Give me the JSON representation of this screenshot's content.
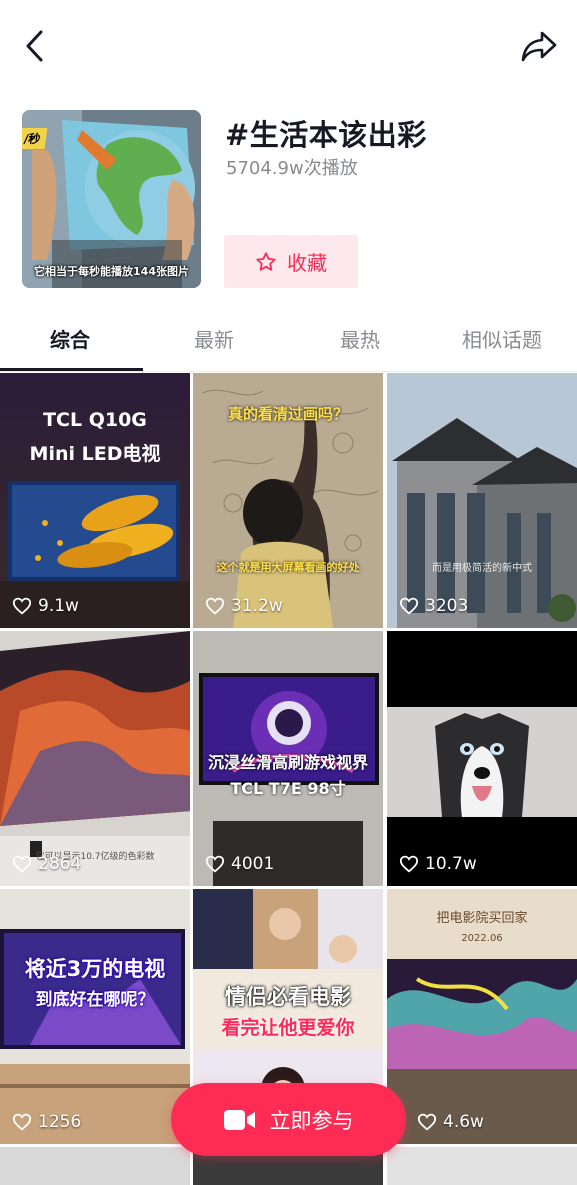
{
  "topic": {
    "title": "#生活本该出彩",
    "views": "5704.9w次播放",
    "favorite_label": "收藏",
    "cover_caption": "它相当于每秒能播放144张图片",
    "cover_tag": "/秒"
  },
  "tabs": [
    {
      "label": "综合",
      "active": true
    },
    {
      "label": "最新",
      "active": false
    },
    {
      "label": "最热",
      "active": false
    },
    {
      "label": "相似话题",
      "active": false
    }
  ],
  "videos": [
    {
      "likes": "9.1w",
      "text_top": "TCL Q10G",
      "text_bottom": "Mini LED电视"
    },
    {
      "likes": "31.2w",
      "text_top": "真的看清过画吗？",
      "text_bottom": "这个就是用大屏幕看画的好处"
    },
    {
      "likes": "3203",
      "text_bottom": "而是用极简活的新中式"
    },
    {
      "likes": "2864",
      "text_bottom": "它可以显示10.7亿级的色彩数"
    },
    {
      "likes": "4001",
      "text_top": "沉浸丝滑高刷游戏视界",
      "text_bottom": "TCL T7E 98寸"
    },
    {
      "likes": "10.7w"
    },
    {
      "likes": "1256",
      "text_top": "将近3万的电视",
      "text_bottom": "到底好在哪呢？"
    },
    {
      "likes": "",
      "text_top": "情侣必看电影",
      "text_bottom": "看完让他更爱你"
    },
    {
      "likes": "4.6w",
      "text_top": "把电影院买回家",
      "text_bottom": "2022.06"
    }
  ],
  "join_button": {
    "label": "立即参与"
  },
  "colors": {
    "accent": "#fe2c55",
    "text_primary": "#161823",
    "text_secondary": "#8a8b91"
  }
}
